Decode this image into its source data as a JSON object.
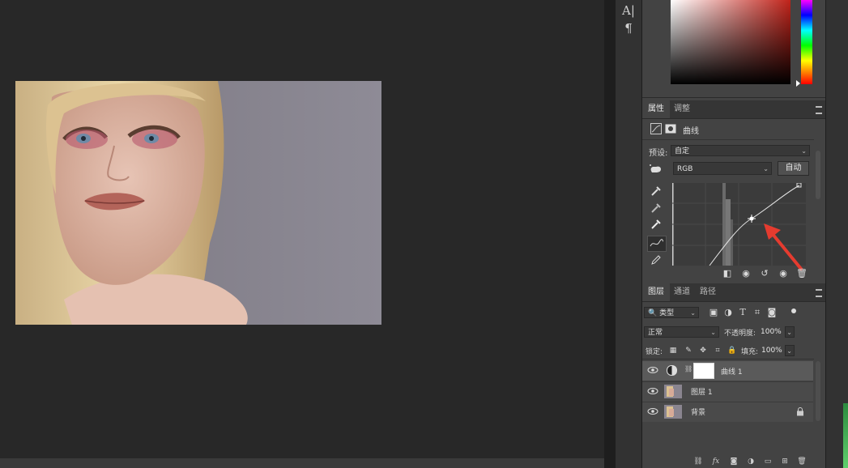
{
  "tool_strip": {
    "char_icon": "A|",
    "para_icon": "¶"
  },
  "color_panel": {
    "field_hue": "#c0231a"
  },
  "properties": {
    "tabs": [
      "属性",
      "调整"
    ],
    "header_title": "曲线",
    "preset_label": "预设:",
    "preset_value": "自定",
    "channel_value": "RGB",
    "auto_label": "自动"
  },
  "layers": {
    "tabs": [
      "图层",
      "通道",
      "路径"
    ],
    "filter_value": "类型",
    "blend_mode": "正常",
    "opacity_label": "不透明度:",
    "opacity_value": "100%",
    "lock_label": "锁定:",
    "fill_label": "填充:",
    "fill_value": "100%",
    "items": [
      {
        "name": "曲线 1"
      },
      {
        "name": "图层 1"
      },
      {
        "name": "背景"
      }
    ]
  },
  "bottom_bar": {
    "fx": "fx"
  },
  "colors": {
    "accent_arrow": "#e53b2f",
    "panel_bg": "#434343",
    "canvas_bg": "#282828"
  }
}
